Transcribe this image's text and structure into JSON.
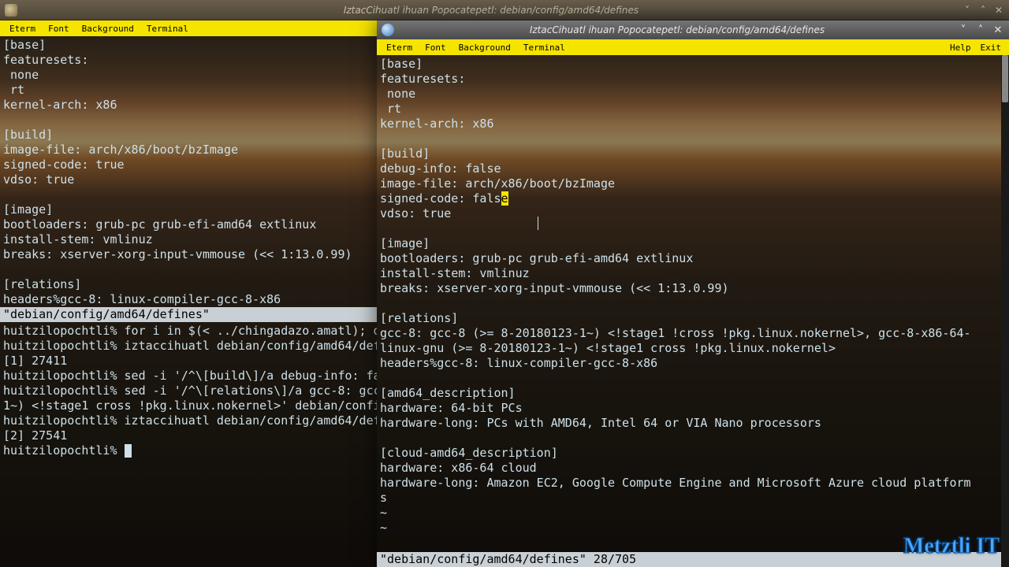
{
  "back_window": {
    "title": "IztacCihuatl ihuan Popocatepetl: debian/config/amd64/defines",
    "buttons": {
      "min": "˅",
      "max": "˄",
      "close": "✕"
    }
  },
  "front_window": {
    "title": "IztacCihuatl ihuan Popocatepetl: debian/config/amd64/defines",
    "buttons": {
      "min": "˅",
      "max": "˄",
      "close": "✕"
    }
  },
  "menubar": {
    "items": [
      "Eterm",
      "Font",
      "Background",
      "Terminal"
    ],
    "right": [
      "Help",
      "Exit"
    ]
  },
  "left_term": {
    "pre_status": "[base]\nfeaturesets:\n none\n rt\nkernel-arch: x86\n\n[build]\nimage-file: arch/x86/boot/bzImage\nsigned-code: true\nvdso: true\n\n[image]\nbootloaders: grub-pc grub-efi-amd64 extlinux\ninstall-stem: vmlinuz\nbreaks: xserver-xorg-input-vmmouse (<< 1:13.0.99)\n\n[relations]\nheaders%gcc-8: linux-compiler-gcc-8-x86\n",
    "status": "\"debian/config/amd64/defines\"",
    "post_status": "huitzilopochtli% for i in $(< ../chingadazo.amatl); do s\nhuitzilopochtli% iztaccihuatl debian/config/amd64/defines\n[1] 27411\nhuitzilopochtli% sed -i '/^\\[build\\]/a debug-info: false\nhuitzilopochtli% sed -i '/^\\[relations\\]/a gcc-8: gcc-8 \n1~) <!stage1 cross !pkg.linux.nokernel>' debian/config/ar\nhuitzilopochtli% iztaccihuatl debian/config/amd64/defines\n[2] 27541\nhuitzilopochtli% "
  },
  "right_term": {
    "lines_a": "[base]\nfeaturesets:\n none\n rt\nkernel-arch: x86\n\n[build]\ndebug-info: false\nimage-file: arch/x86/boot/bzImage\nsigned-code: fals",
    "hl_char": "e",
    "lines_b": "\nvdso: true\n\n[image]\nbootloaders: grub-pc grub-efi-amd64 extlinux\ninstall-stem: vmlinuz\nbreaks: xserver-xorg-input-vmmouse (<< 1:13.0.99)\n\n[relations]\ngcc-8: gcc-8 (>= 8-20180123-1~) <!stage1 !cross !pkg.linux.nokernel>, gcc-8-x86-64-\nlinux-gnu (>= 8-20180123-1~) <!stage1 cross !pkg.linux.nokernel>\nheaders%gcc-8: linux-compiler-gcc-8-x86\n\n[amd64_description]\nhardware: 64-bit PCs\nhardware-long: PCs with AMD64, Intel 64 or VIA Nano processors\n\n[cloud-amd64_description]\nhardware: x86-64 cloud\nhardware-long: Amazon EC2, Google Compute Engine and Microsoft Azure cloud platform\ns\n~\n~",
    "status": "\"debian/config/amd64/defines\" 28/705"
  },
  "watermark": "Metztli IT"
}
